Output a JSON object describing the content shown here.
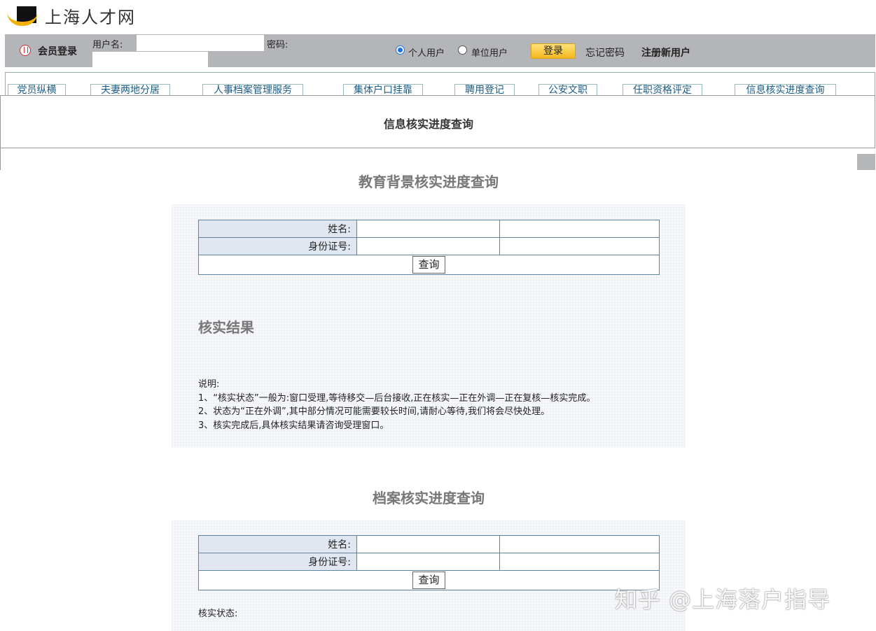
{
  "header": {
    "logo_text": "上海人才网"
  },
  "login": {
    "member_label": "会员登录",
    "username_label": "用户名:",
    "password_label": "密码:",
    "username_value": "",
    "password_value": "",
    "radio_personal": "个人用户",
    "radio_company": "单位用户",
    "selected_user_type": "个人用户",
    "login_button": "登录",
    "forgot_password": "忘记密码",
    "register": "注册新用户"
  },
  "nav": {
    "tabs": [
      "党员纵横",
      "夫妻两地分居",
      "人事档案管理服务",
      "集体户口挂靠",
      "聘用登记",
      "公安文职",
      "任职资格评定",
      "信息核实进度查询"
    ]
  },
  "page_title": "信息核实进度查询",
  "education_section": {
    "title": "教育背景核实进度查询",
    "name_label": "姓名:",
    "id_label": "身份证号:",
    "name_value": "",
    "id_value": "",
    "query_button": "查询",
    "result_heading": "核实结果",
    "notes": [
      "说明:",
      "1、“核实状态”一般为:窗口受理,等待移交—后台接收,正在核实—正在外调—正在复核—核实完成。",
      "2、状态为“正在外调”,其中部分情况可能需要较长时间,请耐心等待,我们将会尽快处理。",
      "3、核实完成后,具体核实结果请咨询受理窗口。"
    ]
  },
  "archive_section": {
    "title": "档案核实进度查询",
    "name_label": "姓名:",
    "id_label": "身份证号:",
    "name_value": "",
    "id_value": "",
    "query_button": "查询",
    "status_label": "核实状态:"
  },
  "watermark": "知乎 @上海落户指导",
  "colors": {
    "login_bar": "#b4b5b8",
    "label_cell": "#e1e7f0",
    "table_border": "#5b85a1",
    "login_button": "#f3b71c",
    "nav_link": "#1d5c86"
  }
}
